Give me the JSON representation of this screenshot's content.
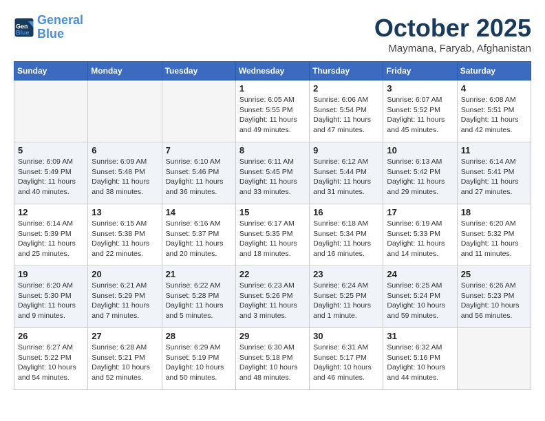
{
  "header": {
    "logo_line1": "General",
    "logo_line2": "Blue",
    "month": "October 2025",
    "location": "Maymana, Faryab, Afghanistan"
  },
  "days_of_week": [
    "Sunday",
    "Monday",
    "Tuesday",
    "Wednesday",
    "Thursday",
    "Friday",
    "Saturday"
  ],
  "weeks": [
    {
      "alt": false,
      "days": [
        {
          "num": "",
          "info": ""
        },
        {
          "num": "",
          "info": ""
        },
        {
          "num": "",
          "info": ""
        },
        {
          "num": "1",
          "info": "Sunrise: 6:05 AM\nSunset: 5:55 PM\nDaylight: 11 hours\nand 49 minutes."
        },
        {
          "num": "2",
          "info": "Sunrise: 6:06 AM\nSunset: 5:54 PM\nDaylight: 11 hours\nand 47 minutes."
        },
        {
          "num": "3",
          "info": "Sunrise: 6:07 AM\nSunset: 5:52 PM\nDaylight: 11 hours\nand 45 minutes."
        },
        {
          "num": "4",
          "info": "Sunrise: 6:08 AM\nSunset: 5:51 PM\nDaylight: 11 hours\nand 42 minutes."
        }
      ]
    },
    {
      "alt": true,
      "days": [
        {
          "num": "5",
          "info": "Sunrise: 6:09 AM\nSunset: 5:49 PM\nDaylight: 11 hours\nand 40 minutes."
        },
        {
          "num": "6",
          "info": "Sunrise: 6:09 AM\nSunset: 5:48 PM\nDaylight: 11 hours\nand 38 minutes."
        },
        {
          "num": "7",
          "info": "Sunrise: 6:10 AM\nSunset: 5:46 PM\nDaylight: 11 hours\nand 36 minutes."
        },
        {
          "num": "8",
          "info": "Sunrise: 6:11 AM\nSunset: 5:45 PM\nDaylight: 11 hours\nand 33 minutes."
        },
        {
          "num": "9",
          "info": "Sunrise: 6:12 AM\nSunset: 5:44 PM\nDaylight: 11 hours\nand 31 minutes."
        },
        {
          "num": "10",
          "info": "Sunrise: 6:13 AM\nSunset: 5:42 PM\nDaylight: 11 hours\nand 29 minutes."
        },
        {
          "num": "11",
          "info": "Sunrise: 6:14 AM\nSunset: 5:41 PM\nDaylight: 11 hours\nand 27 minutes."
        }
      ]
    },
    {
      "alt": false,
      "days": [
        {
          "num": "12",
          "info": "Sunrise: 6:14 AM\nSunset: 5:39 PM\nDaylight: 11 hours\nand 25 minutes."
        },
        {
          "num": "13",
          "info": "Sunrise: 6:15 AM\nSunset: 5:38 PM\nDaylight: 11 hours\nand 22 minutes."
        },
        {
          "num": "14",
          "info": "Sunrise: 6:16 AM\nSunset: 5:37 PM\nDaylight: 11 hours\nand 20 minutes."
        },
        {
          "num": "15",
          "info": "Sunrise: 6:17 AM\nSunset: 5:35 PM\nDaylight: 11 hours\nand 18 minutes."
        },
        {
          "num": "16",
          "info": "Sunrise: 6:18 AM\nSunset: 5:34 PM\nDaylight: 11 hours\nand 16 minutes."
        },
        {
          "num": "17",
          "info": "Sunrise: 6:19 AM\nSunset: 5:33 PM\nDaylight: 11 hours\nand 14 minutes."
        },
        {
          "num": "18",
          "info": "Sunrise: 6:20 AM\nSunset: 5:32 PM\nDaylight: 11 hours\nand 11 minutes."
        }
      ]
    },
    {
      "alt": true,
      "days": [
        {
          "num": "19",
          "info": "Sunrise: 6:20 AM\nSunset: 5:30 PM\nDaylight: 11 hours\nand 9 minutes."
        },
        {
          "num": "20",
          "info": "Sunrise: 6:21 AM\nSunset: 5:29 PM\nDaylight: 11 hours\nand 7 minutes."
        },
        {
          "num": "21",
          "info": "Sunrise: 6:22 AM\nSunset: 5:28 PM\nDaylight: 11 hours\nand 5 minutes."
        },
        {
          "num": "22",
          "info": "Sunrise: 6:23 AM\nSunset: 5:26 PM\nDaylight: 11 hours\nand 3 minutes."
        },
        {
          "num": "23",
          "info": "Sunrise: 6:24 AM\nSunset: 5:25 PM\nDaylight: 11 hours\nand 1 minute."
        },
        {
          "num": "24",
          "info": "Sunrise: 6:25 AM\nSunset: 5:24 PM\nDaylight: 10 hours\nand 59 minutes."
        },
        {
          "num": "25",
          "info": "Sunrise: 6:26 AM\nSunset: 5:23 PM\nDaylight: 10 hours\nand 56 minutes."
        }
      ]
    },
    {
      "alt": false,
      "days": [
        {
          "num": "26",
          "info": "Sunrise: 6:27 AM\nSunset: 5:22 PM\nDaylight: 10 hours\nand 54 minutes."
        },
        {
          "num": "27",
          "info": "Sunrise: 6:28 AM\nSunset: 5:21 PM\nDaylight: 10 hours\nand 52 minutes."
        },
        {
          "num": "28",
          "info": "Sunrise: 6:29 AM\nSunset: 5:19 PM\nDaylight: 10 hours\nand 50 minutes."
        },
        {
          "num": "29",
          "info": "Sunrise: 6:30 AM\nSunset: 5:18 PM\nDaylight: 10 hours\nand 48 minutes."
        },
        {
          "num": "30",
          "info": "Sunrise: 6:31 AM\nSunset: 5:17 PM\nDaylight: 10 hours\nand 46 minutes."
        },
        {
          "num": "31",
          "info": "Sunrise: 6:32 AM\nSunset: 5:16 PM\nDaylight: 10 hours\nand 44 minutes."
        },
        {
          "num": "",
          "info": ""
        }
      ]
    }
  ]
}
